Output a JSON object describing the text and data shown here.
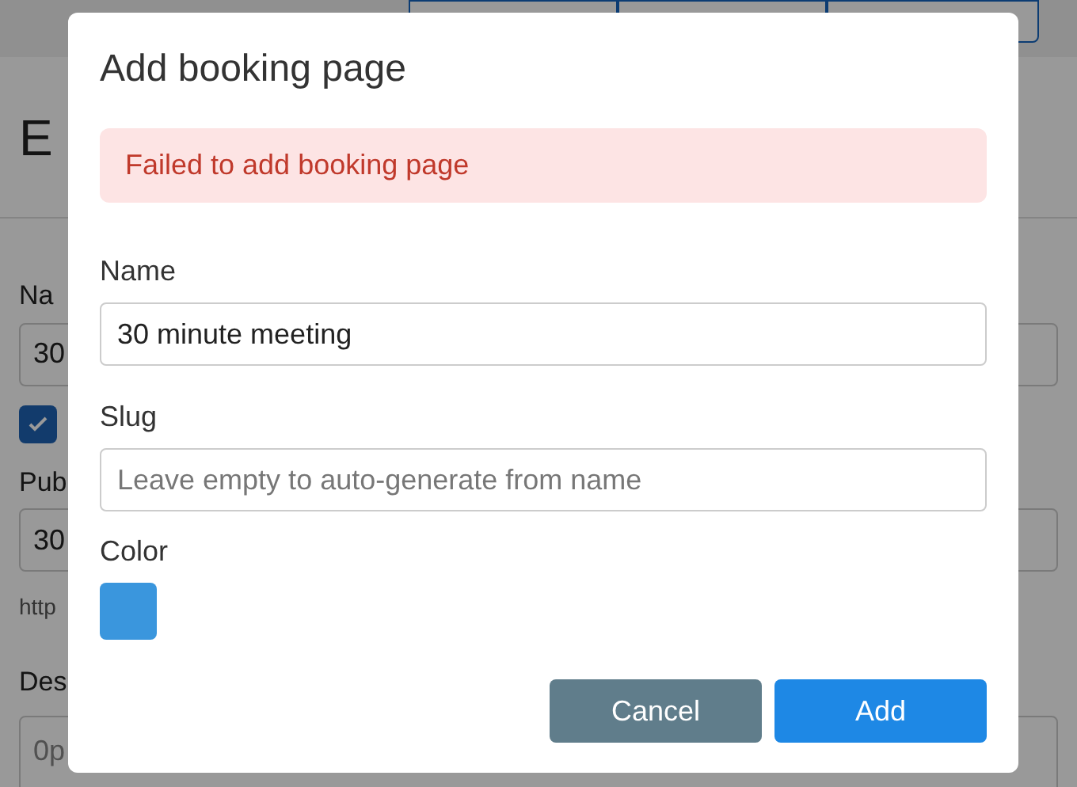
{
  "background": {
    "heading": "E",
    "fields": [
      {
        "kind": "input",
        "label": "Na",
        "value": "30"
      },
      {
        "kind": "checkbox",
        "checked": true
      },
      {
        "kind": "input",
        "label": "Pub",
        "value": "30",
        "hint": "http"
      },
      {
        "kind": "textarea",
        "label": "Des",
        "placeholder": "0p"
      }
    ]
  },
  "dialog": {
    "title": "Add booking page",
    "error": "Failed to add booking page",
    "fields": [
      {
        "label": "Name",
        "value": "30 minute meeting"
      },
      {
        "label": "Slug",
        "placeholder": "Leave empty to auto-generate from name"
      }
    ],
    "color_field": {
      "label": "Color",
      "color": "#3a96dd"
    },
    "buttons": [
      {
        "label": "Cancel",
        "kind": "secondary"
      },
      {
        "label": "Add",
        "kind": "primary"
      }
    ]
  }
}
